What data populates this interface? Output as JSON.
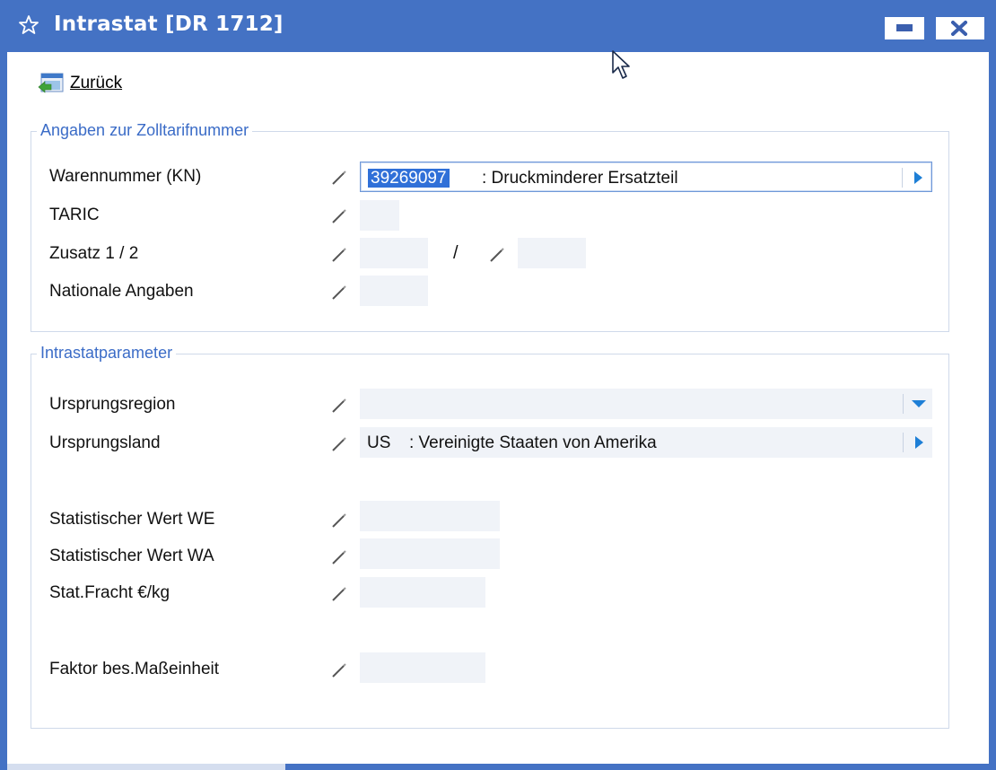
{
  "window": {
    "title": "Intrastat [DR 1712]"
  },
  "toolbar": {
    "back_label": "Zurück"
  },
  "group_zolltarif": {
    "legend": "Angaben zur Zolltarifnummer",
    "warennummer": {
      "label": "Warennummer (KN)",
      "code": "39269097",
      "description": ": Druckminderer Ersatzteil"
    },
    "taric": {
      "label": "TARIC",
      "value": ""
    },
    "zusatz": {
      "label": "Zusatz 1 / 2",
      "value1": "",
      "separator": "/",
      "value2": ""
    },
    "nationale": {
      "label": "Nationale Angaben",
      "value": ""
    }
  },
  "group_intrastat": {
    "legend": "Intrastatparameter",
    "ursprungsregion": {
      "label": "Ursprungsregion",
      "value": ""
    },
    "ursprungsland": {
      "label": "Ursprungsland",
      "code": "US",
      "description": ": Vereinigte Staaten von Amerika"
    },
    "stat_wert_we": {
      "label": "Statistischer Wert WE",
      "value": ""
    },
    "stat_wert_wa": {
      "label": "Statistischer Wert WA",
      "value": ""
    },
    "stat_fracht": {
      "label": "Stat.Fracht €/kg",
      "value": ""
    },
    "faktor": {
      "label": "Faktor bes.Maßeinheit",
      "value": ""
    }
  },
  "colors": {
    "titlebar": "#4472c4",
    "legend_text": "#3b6cc7",
    "selection": "#3070d8",
    "arrow": "#1e7fd6",
    "field_bg": "#f0f3f8"
  },
  "icons": [
    "star-icon",
    "minimize-icon",
    "close-icon",
    "back-icon",
    "pencil-icon",
    "chevron-right-icon",
    "chevron-down-icon",
    "mouse-pointer-icon"
  ]
}
